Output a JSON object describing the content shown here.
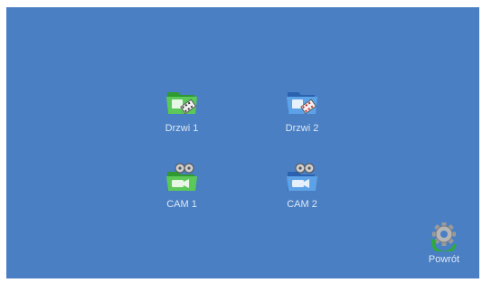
{
  "screen": {
    "background": "#4a7fc3",
    "tiles": [
      {
        "label": "Drzwi 1",
        "icon": "green-video-folder-icon",
        "color": "#3cae3c"
      },
      {
        "label": "Drzwi 2",
        "icon": "blue-video-folder-icon",
        "color": "#3b7fd0"
      },
      {
        "label": "CAM 1",
        "icon": "green-camera-folder-icon",
        "color": "#3cae3c"
      },
      {
        "label": "CAM 2",
        "icon": "blue-camera-folder-icon",
        "color": "#3b7fd0"
      }
    ],
    "back": {
      "label": "Powrót",
      "icon": "back-gear-icon"
    }
  }
}
